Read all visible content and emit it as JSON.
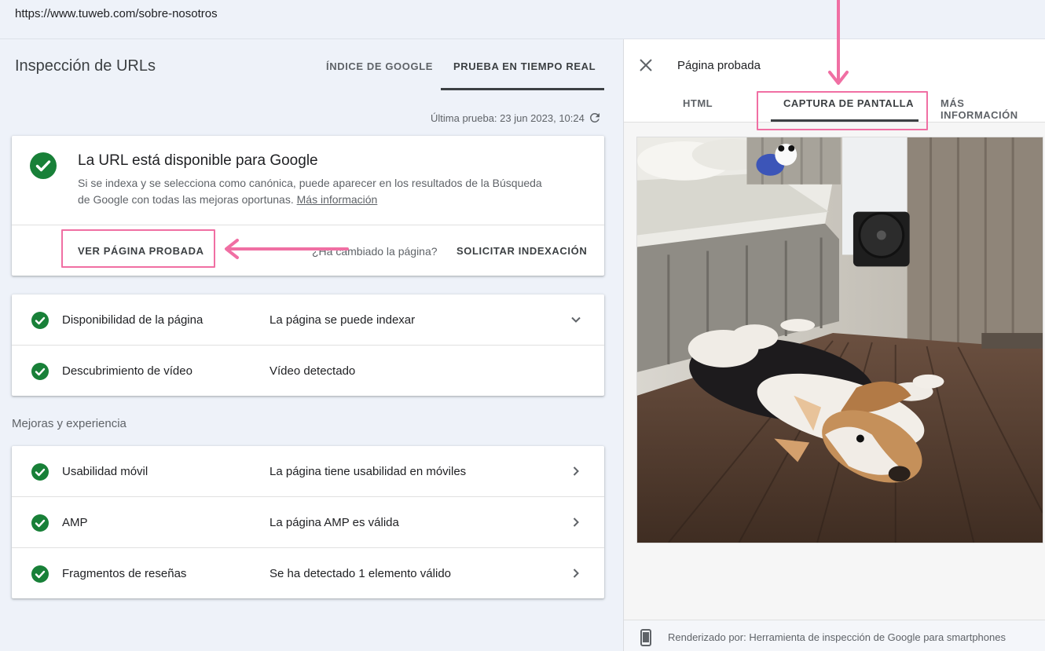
{
  "browser": {
    "url": "https://www.tuweb.com/sobre-nosotros"
  },
  "header": {
    "title": "Inspección de URLs",
    "tabs": [
      {
        "label": "ÍNDICE DE GOOGLE",
        "active": false
      },
      {
        "label": "PRUEBA EN TIEMPO REAL",
        "active": true
      }
    ],
    "last_test": "Última prueba: 23 jun 2023, 10:24"
  },
  "status": {
    "title": "La URL está disponible para Google",
    "description": "Si se indexa y se selecciona como canónica, puede aparecer en los resultados de la Búsqueda de Google con todas las mejoras oportunas.",
    "more_link": "Más información",
    "view_tested_button": "VER PÁGINA PROBADA",
    "changed_question": "¿Ha cambiado la página?",
    "request_indexing_button": "SOLICITAR INDEXACIÓN"
  },
  "coverage": [
    {
      "label": "Disponibilidad de la página",
      "value": "La página se puede indexar",
      "chevron": "expand-more"
    },
    {
      "label": "Descubrimiento de vídeo",
      "value": "Vídeo detectado",
      "chevron": ""
    }
  ],
  "enhancements_heading": "Mejoras y experiencia",
  "enhancements": [
    {
      "label": "Usabilidad móvil",
      "value": "La página tiene usabilidad en móviles"
    },
    {
      "label": "AMP",
      "value": "La página AMP es válida"
    },
    {
      "label": "Fragmentos de reseñas",
      "value": "Se ha detectado 1 elemento válido"
    }
  ],
  "panel": {
    "title": "Página probada",
    "tabs": [
      {
        "label": "HTML",
        "active": false
      },
      {
        "label": "CAPTURA DE PANTALLA",
        "active": true
      },
      {
        "label": "MÁS INFORMACIÓN",
        "active": false
      }
    ],
    "footer": "Renderizado por: Herramienta de inspección de Google para smartphones"
  },
  "colors": {
    "accent_check": "#188038",
    "annotation_pink": "#f06fa3",
    "page_bg": "#eef2f9"
  }
}
